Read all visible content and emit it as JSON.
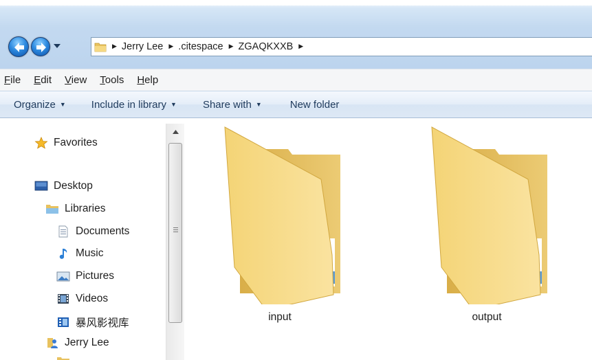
{
  "addressbar": {
    "crumbs": [
      "Jerry Lee",
      ".citespace",
      "ZGAQKXXB"
    ]
  },
  "menubar": {
    "items": [
      {
        "key": "F",
        "rest": "ile"
      },
      {
        "key": "E",
        "rest": "dit"
      },
      {
        "key": "V",
        "rest": "iew"
      },
      {
        "key": "T",
        "rest": "ools"
      },
      {
        "key": "H",
        "rest": "elp"
      }
    ]
  },
  "commandbar": {
    "organize": "Organize",
    "include": "Include in library",
    "share": "Share with",
    "newfolder": "New folder"
  },
  "navpane": {
    "favorites": "Favorites",
    "desktop": "Desktop",
    "libraries": "Libraries",
    "documents": "Documents",
    "music": "Music",
    "pictures": "Pictures",
    "videos": "Videos",
    "baofeng": "暴风影视库",
    "jerry": "Jerry Lee"
  },
  "content": {
    "folders": [
      "input",
      "output"
    ]
  },
  "colors": {
    "folder_front": "#f6d982",
    "folder_back": "#e8c25f",
    "accent": "#2e8be0"
  }
}
